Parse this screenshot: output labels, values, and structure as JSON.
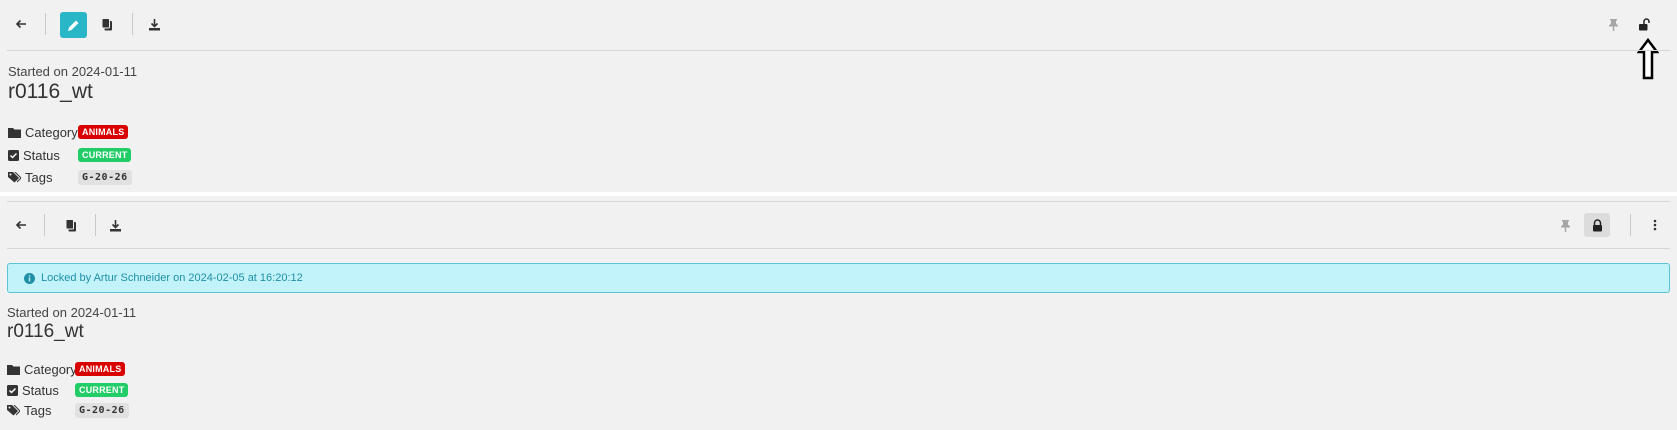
{
  "top": {
    "started": "Started on 2024-01-11",
    "title": "r0116_wt",
    "category_label": "Category",
    "category_value": "ANIMALS",
    "status_label": "Status",
    "status_value": "CURRENT",
    "tags_label": "Tags",
    "tag": "G-20-26"
  },
  "bottom": {
    "alert": "Locked by Artur Schneider on 2024-02-05 at 16:20:12",
    "started": "Started on 2024-01-11",
    "title": "r0116_wt",
    "category_label": "Category",
    "category_value": "ANIMALS",
    "status_label": "Status",
    "status_value": "CURRENT",
    "tags_label": "Tags",
    "tag": "G-20-26"
  },
  "colors": {
    "accent": "#29b6c6",
    "category_badge": "#d90000",
    "status_badge": "#22cc66",
    "alert_bg": "#c2f3fb",
    "alert_text": "#1f8fa6"
  },
  "icons": [
    "arrow-left-icon",
    "pencil-icon",
    "copy-icon",
    "download-icon",
    "pin-icon",
    "unlock-icon",
    "lock-icon",
    "more-vertical-icon",
    "info-icon",
    "folder-icon",
    "checkbox-icon",
    "tags-icon"
  ]
}
